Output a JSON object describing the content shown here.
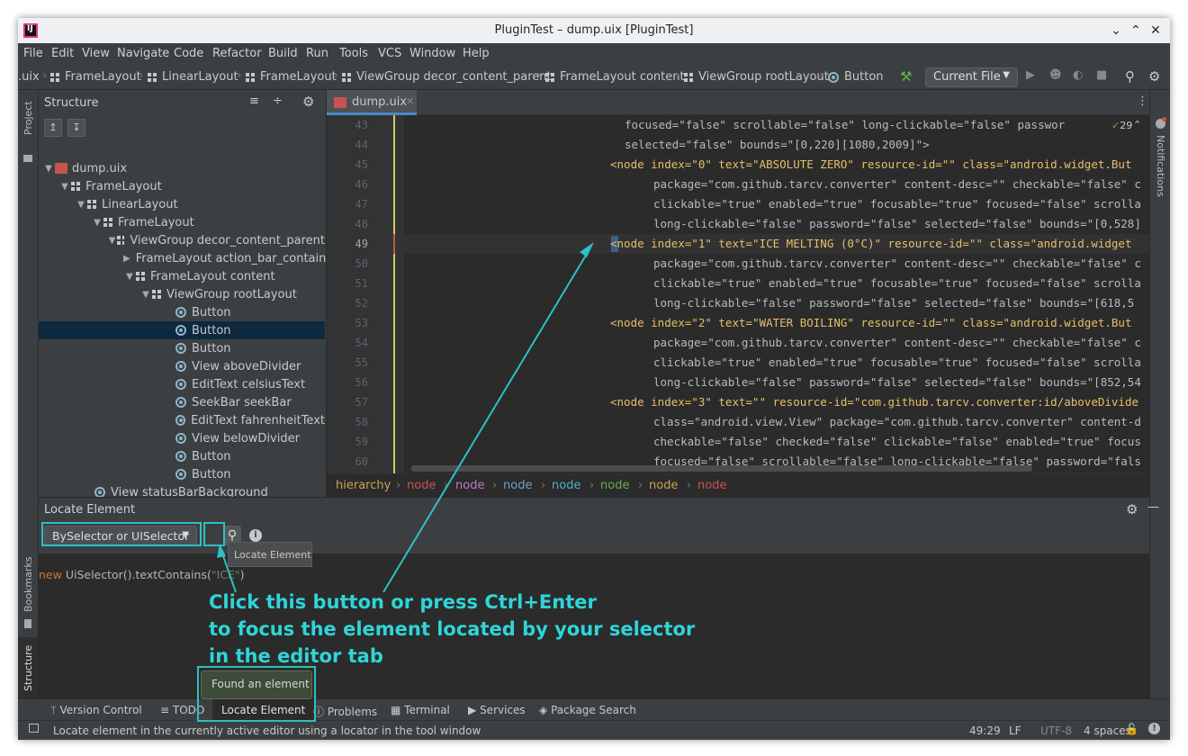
{
  "window": {
    "title": "PluginTest – dump.uix [PluginTest]"
  },
  "menu": [
    "File",
    "Edit",
    "View",
    "Navigate",
    "Code",
    "Refactor",
    "Build",
    "Run",
    "Tools",
    "VCS",
    "Window",
    "Help"
  ],
  "breadcrumbs": [
    ".uix",
    "FrameLayout",
    "LinearLayout",
    "FrameLayout",
    "ViewGroup decor_content_parent",
    "FrameLayout content",
    "ViewGroup rootLayout",
    "Button"
  ],
  "run_config": "Current File",
  "structure": {
    "title": "Structure",
    "nodes": [
      "dump.uix",
      "FrameLayout",
      "LinearLayout",
      "FrameLayout",
      "ViewGroup decor_content_parent",
      "FrameLayout action_bar_contain",
      "FrameLayout content",
      "ViewGroup rootLayout",
      "Button",
      "Button",
      "Button",
      "View aboveDivider",
      "EditText celsiusText",
      "SeekBar seekBar",
      "EditText fahrenheitText",
      "View belowDivider",
      "Button",
      "Button",
      "View statusBarBackground"
    ]
  },
  "editor": {
    "tab": "dump.uix",
    "inspection_count": "29",
    "line_numbers": [
      "43",
      "44",
      "45",
      "46",
      "47",
      "48",
      "49",
      "50",
      "51",
      "52",
      "53",
      "54",
      "55",
      "56",
      "57",
      "58",
      "59",
      "60"
    ],
    "lines": [
      "focused=\"false\" scrollable=\"false\" long-clickable=\"false\" passwor",
      "selected=\"false\" bounds=\"[0,220][1080,2009]\">",
      "<node index=\"0\" text=\"ABSOLUTE ZERO\" resource-id=\"\" class=\"android.widget.But",
      "package=\"com.github.tarcv.converter\" content-desc=\"\" checkable=\"false\" c",
      "clickable=\"true\" enabled=\"true\" focusable=\"true\" focused=\"false\" scrolla",
      "long-clickable=\"false\" password=\"false\" selected=\"false\" bounds=\"[0,528]",
      "<node index=\"1\" text=\"ICE MELTING (0°C)\" resource-id=\"\" class=\"android.widget",
      "package=\"com.github.tarcv.converter\" content-desc=\"\" checkable=\"false\" c",
      "clickable=\"true\" enabled=\"true\" focusable=\"true\" focused=\"false\" scrolla",
      "long-clickable=\"false\" password=\"false\" selected=\"false\" bounds=\"[618,5",
      "<node index=\"2\" text=\"WATER BOILING\" resource-id=\"\" class=\"android.widget.But",
      "package=\"com.github.tarcv.converter\" content-desc=\"\" checkable=\"false\" c",
      "clickable=\"true\" enabled=\"true\" focusable=\"true\" focused=\"false\" scrolla",
      "long-clickable=\"false\" password=\"false\" selected=\"false\" bounds=\"[852,54",
      "<node index=\"3\" text=\"\" resource-id=\"com.github.tarcv.converter:id/aboveDivide",
      "class=\"android.view.View\" package=\"com.github.tarcv.converter\" content-d",
      "checkable=\"false\" checked=\"false\" clickable=\"false\" enabled=\"true\" focus",
      "focused=\"false\" scrollable=\"false\" long-clickable=\"false\" password=\"fals"
    ],
    "hierarchy": [
      "hierarchy",
      "node",
      "node",
      "node",
      "node",
      "node",
      "node",
      "node"
    ]
  },
  "locate": {
    "title": "Locate Element",
    "selector_type": "BySelector or UISelector",
    "query_new": "new",
    "query_call": " UiSelector().textContains(",
    "query_arg": "\"ICE\"",
    "query_end": ")",
    "tooltip": "Locate Element",
    "found_message": "Found an element"
  },
  "annotation": [
    "Click this button or press Ctrl+Enter",
    "to focus the element located by your selector",
    "in the editor tab"
  ],
  "side_labels": {
    "project": "Project",
    "bookmarks": "Bookmarks",
    "structure": "Structure",
    "notifications": "Notifications"
  },
  "bottom_tabs": [
    "Version Control",
    "TODO",
    "Locate Element",
    "Problems",
    "Terminal",
    "Services",
    "Package Search"
  ],
  "status": {
    "message": "Locate element in the currently active editor using a locator in the tool window",
    "position": "49:29",
    "line_sep": "LF",
    "encoding": "UTF-8",
    "indent": "4 spaces"
  }
}
